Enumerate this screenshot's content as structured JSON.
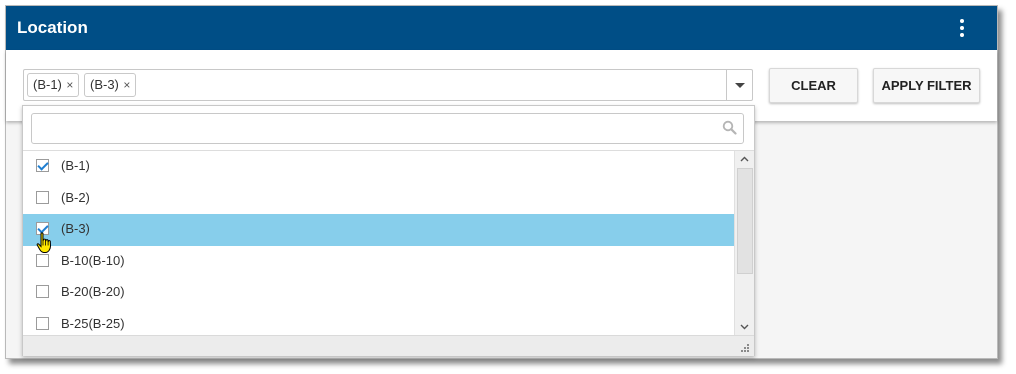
{
  "header": {
    "title": "Location",
    "menu_icon": "more-vertical-icon"
  },
  "filter": {
    "chips": [
      {
        "label": "(B-1)",
        "remove": "×"
      },
      {
        "label": "(B-3)",
        "remove": "×"
      }
    ],
    "clear_label": "CLEAR",
    "apply_label": "APPLY FILTER"
  },
  "dropdown": {
    "search_value": "",
    "search_placeholder": "",
    "options": [
      {
        "label": "(B-1)",
        "checked": true,
        "highlighted": false
      },
      {
        "label": "(B-2)",
        "checked": false,
        "highlighted": false
      },
      {
        "label": "(B-3)",
        "checked": true,
        "highlighted": true
      },
      {
        "label": "B-10(B-10)",
        "checked": false,
        "highlighted": false
      },
      {
        "label": "B-20(B-20)",
        "checked": false,
        "highlighted": false
      },
      {
        "label": "B-25(B-25)",
        "checked": false,
        "highlighted": false
      }
    ]
  },
  "colors": {
    "header_bg": "#004e86",
    "highlight_bg": "#87ceeb",
    "checkmark": "#1f7ed0"
  }
}
